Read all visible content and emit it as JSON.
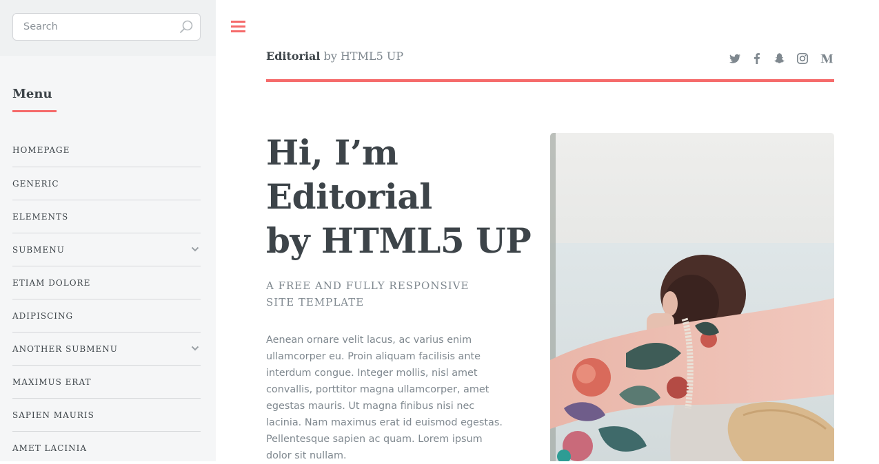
{
  "sidebar": {
    "search": {
      "placeholder": "Search",
      "value": ""
    },
    "menu_heading": "Menu",
    "items": [
      {
        "label": "HOMEPAGE",
        "has_submenu": false
      },
      {
        "label": "GENERIC",
        "has_submenu": false
      },
      {
        "label": "ELEMENTS",
        "has_submenu": false
      },
      {
        "label": "SUBMENU",
        "has_submenu": true
      },
      {
        "label": "ETIAM DOLORE",
        "has_submenu": false
      },
      {
        "label": "ADIPISCING",
        "has_submenu": false
      },
      {
        "label": "ANOTHER SUBMENU",
        "has_submenu": true
      },
      {
        "label": "MAXIMUS ERAT",
        "has_submenu": false
      },
      {
        "label": "SAPIEN MAURIS",
        "has_submenu": false
      },
      {
        "label": "AMET LACINIA",
        "has_submenu": false
      }
    ]
  },
  "header": {
    "brand_strong": "Editorial",
    "brand_rest": " by HTML5 UP",
    "social_icons": [
      "twitter-icon",
      "facebook-icon",
      "snapchat-icon",
      "instagram-icon",
      "medium-icon"
    ]
  },
  "hero": {
    "title_lines": [
      "Hi, I’m",
      "Editorial",
      "by HTML5 UP"
    ],
    "subtitle": "A FREE AND FULLY RESPONSIVE SITE TEMPLATE",
    "body": "Aenean ornare velit lacus, ac varius enim ullamcorper eu. Proin aliquam facilisis ante interdum congue. Integer mollis, nisl amet convallis, porttitor magna ullamcorper, amet egestas mauris. Ut magna finibus nisi nec lacinia. Nam maximus erat id euismod egestas. Pellentesque sapien ac quam. Lorem ipsum dolor sit nullam."
  },
  "colors": {
    "accent": "#f56a6a",
    "heading": "#3d4449",
    "text": "#7f888f",
    "sidebar_bg": "#f5f6f7",
    "search_band_bg": "#eff1f2"
  }
}
